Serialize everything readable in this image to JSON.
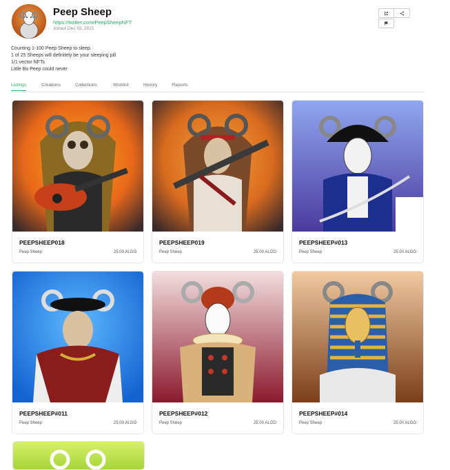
{
  "profile": {
    "name": "Peep Sheep",
    "link": "https://twitter.com/PeepSheepNFT",
    "joined": "Joined Dec 02, 2021",
    "bio": [
      "Counting 1-100 Peep Sheep to sleep.",
      "1 of 25 Sheeps will definitely be your sleeping pill",
      "1/1 vector NFTs",
      "Little Bo Peep could never"
    ]
  },
  "actions": {
    "edit_icon": "external-link-icon",
    "share_icon": "share-icon",
    "report_icon": "flag-icon"
  },
  "tabs": [
    {
      "label": "Listings",
      "active": true
    },
    {
      "label": "Creations",
      "active": false
    },
    {
      "label": "Collections",
      "active": false
    },
    {
      "label": "Wishlist",
      "active": false
    },
    {
      "label": "History",
      "active": false
    },
    {
      "label": "Reports",
      "active": false
    }
  ],
  "cards": [
    {
      "title": "PEEPSHEEP018",
      "creator": "Peep Sheep",
      "price": "25.00 ALGO",
      "bg": "#e8681a"
    },
    {
      "title": "PEEPSHEEP019",
      "creator": "Peep Sheep",
      "price": "25.00 ALGO",
      "bg": "#e0761d"
    },
    {
      "title": "PEEPSHEEP#013",
      "creator": "Peep Sheep",
      "price": "25.00 ALGO",
      "bg": "#6e73d6"
    },
    {
      "title": "PEEPSHEEP#011",
      "creator": "Peep Sheep",
      "price": "25.00 ALGO",
      "bg": "#1f86e8"
    },
    {
      "title": "PEEPSHEEP#012",
      "creator": "Peep Sheep",
      "price": "25.00 ALGO",
      "bg": "#a8354a"
    },
    {
      "title": "PEEPSHEEP#014",
      "creator": "Peep Sheep",
      "price": "25.00 ALGO",
      "bg": "#c9884a"
    }
  ],
  "colors": {
    "accent": "#27ae60"
  }
}
